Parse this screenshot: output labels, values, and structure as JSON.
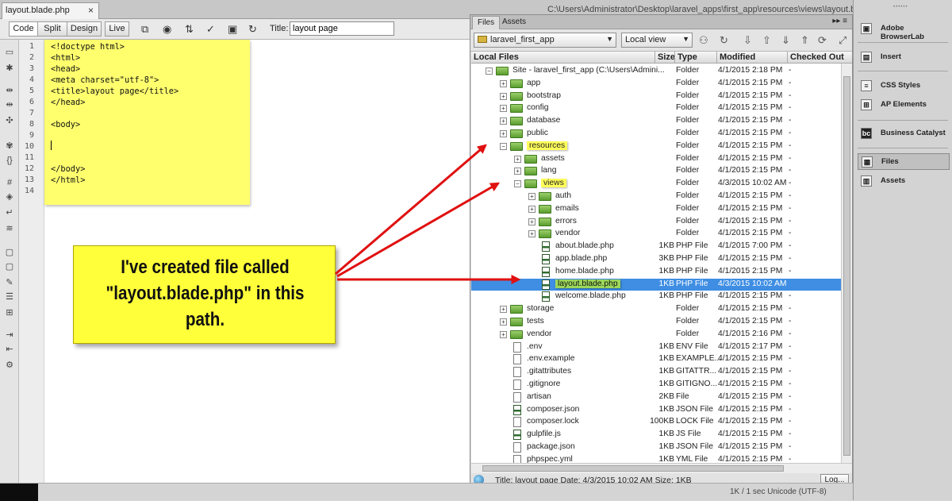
{
  "document_tab": {
    "label": "layout.blade.php",
    "close": "×"
  },
  "window_path": "C:\\Users\\Administrator\\Desktop\\laravel_apps\\first_app\\resources\\views\\layout.blade.php",
  "toolbar": {
    "code": "Code",
    "split": "Split",
    "design": "Design",
    "live": "Live",
    "title_label": "Title:",
    "title_value": "layout page"
  },
  "code_lines": [
    {
      "n": "1",
      "text": "<!doctype html>"
    },
    {
      "n": "2",
      "text": "<html>"
    },
    {
      "n": "3",
      "text": "<head>"
    },
    {
      "n": "4",
      "text": "<meta charset=\"utf-8\">"
    },
    {
      "n": "5",
      "text": "<title>layout page</title>"
    },
    {
      "n": "6",
      "text": "</head>"
    },
    {
      "n": "7",
      "text": ""
    },
    {
      "n": "8",
      "text": "<body>"
    },
    {
      "n": "9",
      "text": ""
    },
    {
      "n": "10",
      "text": ""
    },
    {
      "n": "11",
      "text": ""
    },
    {
      "n": "12",
      "text": "</body>"
    },
    {
      "n": "13",
      "text": "</html>"
    },
    {
      "n": "14",
      "text": ""
    }
  ],
  "callout": {
    "line1": "I've created file called",
    "line2": "\"layout.blade.php\" in this",
    "line3": "path."
  },
  "files_panel": {
    "tab_files": "Files",
    "tab_assets": "Assets",
    "menu": "▸▸ ≡",
    "site_select": "laravel_first_app",
    "view_select": "Local view",
    "columns": {
      "local_files": "Local Files",
      "size": "Size",
      "type": "Type",
      "modified": "Modified",
      "checked_out": "Checked Out"
    },
    "rows": [
      {
        "name": "Site - laravel_first_app (C:\\Users\\Admini...",
        "size": "",
        "type": "Folder",
        "modified": "4/1/2015 2:18 PM",
        "co": "-"
      },
      {
        "name": "app",
        "size": "",
        "type": "Folder",
        "modified": "4/1/2015 2:15 PM",
        "co": "-"
      },
      {
        "name": "bootstrap",
        "size": "",
        "type": "Folder",
        "modified": "4/1/2015 2:15 PM",
        "co": "-"
      },
      {
        "name": "config",
        "size": "",
        "type": "Folder",
        "modified": "4/1/2015 2:15 PM",
        "co": "-"
      },
      {
        "name": "database",
        "size": "",
        "type": "Folder",
        "modified": "4/1/2015 2:15 PM",
        "co": "-"
      },
      {
        "name": "public",
        "size": "",
        "type": "Folder",
        "modified": "4/1/2015 2:15 PM",
        "co": "-"
      },
      {
        "name": "resources",
        "size": "",
        "type": "Folder",
        "modified": "4/1/2015 2:15 PM",
        "co": "-"
      },
      {
        "name": "assets",
        "size": "",
        "type": "Folder",
        "modified": "4/1/2015 2:15 PM",
        "co": "-"
      },
      {
        "name": "lang",
        "size": "",
        "type": "Folder",
        "modified": "4/1/2015 2:15 PM",
        "co": "-"
      },
      {
        "name": "views",
        "size": "",
        "type": "Folder",
        "modified": "4/3/2015 10:02 AM",
        "co": "-"
      },
      {
        "name": "auth",
        "size": "",
        "type": "Folder",
        "modified": "4/1/2015 2:15 PM",
        "co": "-"
      },
      {
        "name": "emails",
        "size": "",
        "type": "Folder",
        "modified": "4/1/2015 2:15 PM",
        "co": "-"
      },
      {
        "name": "errors",
        "size": "",
        "type": "Folder",
        "modified": "4/1/2015 2:15 PM",
        "co": "-"
      },
      {
        "name": "vendor",
        "size": "",
        "type": "Folder",
        "modified": "4/1/2015 2:15 PM",
        "co": "-"
      },
      {
        "name": "about.blade.php",
        "size": "1KB",
        "type": "PHP File",
        "modified": "4/1/2015 7:00 PM",
        "co": "-"
      },
      {
        "name": "app.blade.php",
        "size": "3KB",
        "type": "PHP File",
        "modified": "4/1/2015 2:15 PM",
        "co": "-"
      },
      {
        "name": "home.blade.php",
        "size": "1KB",
        "type": "PHP File",
        "modified": "4/1/2015 2:15 PM",
        "co": "-"
      },
      {
        "name": "layout.blade.php",
        "size": "1KB",
        "type": "PHP File",
        "modified": "4/3/2015 10:02 AM",
        "co": ""
      },
      {
        "name": "welcome.blade.php",
        "size": "1KB",
        "type": "PHP File",
        "modified": "4/1/2015 2:15 PM",
        "co": "-"
      },
      {
        "name": "storage",
        "size": "",
        "type": "Folder",
        "modified": "4/1/2015 2:15 PM",
        "co": "-"
      },
      {
        "name": "tests",
        "size": "",
        "type": "Folder",
        "modified": "4/1/2015 2:15 PM",
        "co": "-"
      },
      {
        "name": "vendor",
        "size": "",
        "type": "Folder",
        "modified": "4/1/2015 2:16 PM",
        "co": "-"
      },
      {
        "name": ".env",
        "size": "1KB",
        "type": "ENV File",
        "modified": "4/1/2015 2:17 PM",
        "co": "-"
      },
      {
        "name": ".env.example",
        "size": "1KB",
        "type": "EXAMPLE...",
        "modified": "4/1/2015 2:15 PM",
        "co": "-"
      },
      {
        "name": ".gitattributes",
        "size": "1KB",
        "type": "GITATTR...",
        "modified": "4/1/2015 2:15 PM",
        "co": "-"
      },
      {
        "name": ".gitignore",
        "size": "1KB",
        "type": "GITIGNO...",
        "modified": "4/1/2015 2:15 PM",
        "co": "-"
      },
      {
        "name": "artisan",
        "size": "2KB",
        "type": "File",
        "modified": "4/1/2015 2:15 PM",
        "co": "-"
      },
      {
        "name": "composer.json",
        "size": "1KB",
        "type": "JSON File",
        "modified": "4/1/2015 2:15 PM",
        "co": "-"
      },
      {
        "name": "composer.lock",
        "size": "100KB",
        "type": "LOCK File",
        "modified": "4/1/2015 2:15 PM",
        "co": "-"
      },
      {
        "name": "gulpfile.js",
        "size": "1KB",
        "type": "JS File",
        "modified": "4/1/2015 2:15 PM",
        "co": "-"
      },
      {
        "name": "package.json",
        "size": "1KB",
        "type": "JSON File",
        "modified": "4/1/2015 2:15 PM",
        "co": "-"
      },
      {
        "name": "phpspec.yml",
        "size": "1KB",
        "type": "YML File",
        "modified": "4/1/2015 2:15 PM",
        "co": "-"
      }
    ],
    "status": "Title: layout page  Date: 4/3/2015 10:02 AM  Size: 1KB",
    "log_button": "Log..."
  },
  "right_panel": {
    "browserlab": "Adobe BrowserLab",
    "insert": "Insert",
    "css_styles": "CSS Styles",
    "ap_elements": "AP Elements",
    "business_catalyst": "Business Catalyst",
    "files": "Files",
    "assets": "Assets"
  },
  "bottom_status": "1K / 1 sec  Unicode (UTF-8)",
  "colors": {
    "highlight_yellow": "#ffff3a",
    "selection_blue": "#3f8ee3",
    "arrow_red": "#e01010"
  }
}
